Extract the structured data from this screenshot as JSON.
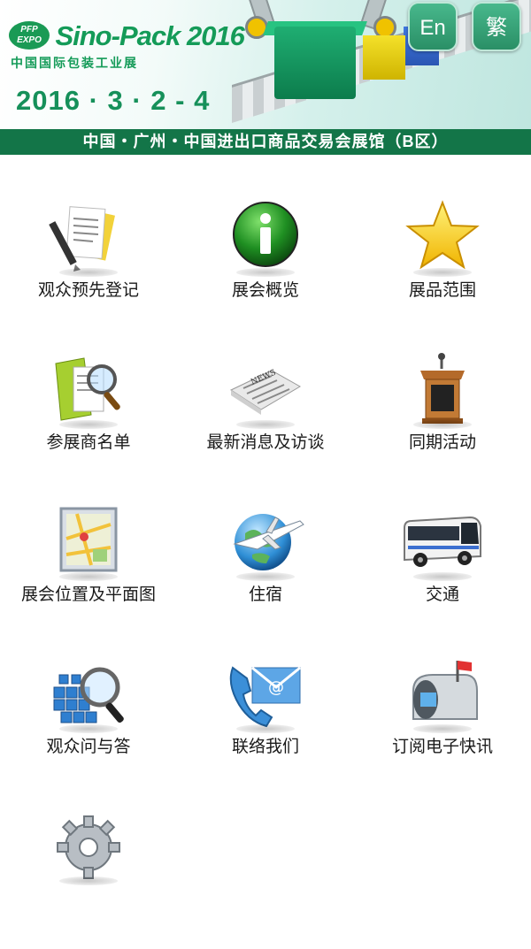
{
  "header": {
    "logo_badge": "PFP EXPO",
    "brand_name": "Sino-Pack 2016",
    "brand_sub": "中国国际包装工业展",
    "dates": "2016 · 3 · 2 - 4",
    "venue": "中国・广州・中国进出口商品交易会展馆（B区）",
    "lang_en": "En",
    "lang_trad": "繁"
  },
  "menu": {
    "items": [
      {
        "label": "观众预先登记",
        "icon": "registration-icon"
      },
      {
        "label": "展会概览",
        "icon": "info-icon"
      },
      {
        "label": "展品范围",
        "icon": "star-icon"
      },
      {
        "label": "参展商名单",
        "icon": "exhibitor-search-icon"
      },
      {
        "label": "最新消息及访谈",
        "icon": "newspaper-icon"
      },
      {
        "label": "同期活动",
        "icon": "podium-icon"
      },
      {
        "label": "展会位置及平面图",
        "icon": "map-icon"
      },
      {
        "label": "住宿",
        "icon": "globe-plane-icon"
      },
      {
        "label": "交通",
        "icon": "bus-icon"
      },
      {
        "label": "观众问与答",
        "icon": "faq-icon"
      },
      {
        "label": "联络我们",
        "icon": "contact-icon"
      },
      {
        "label": "订阅电子快讯",
        "icon": "mailbox-icon"
      },
      {
        "label": "",
        "icon": "gear-icon"
      }
    ]
  },
  "colors": {
    "brand_green": "#149b58",
    "venue_bar": "#137548",
    "lang_button": "#3aa37a"
  }
}
